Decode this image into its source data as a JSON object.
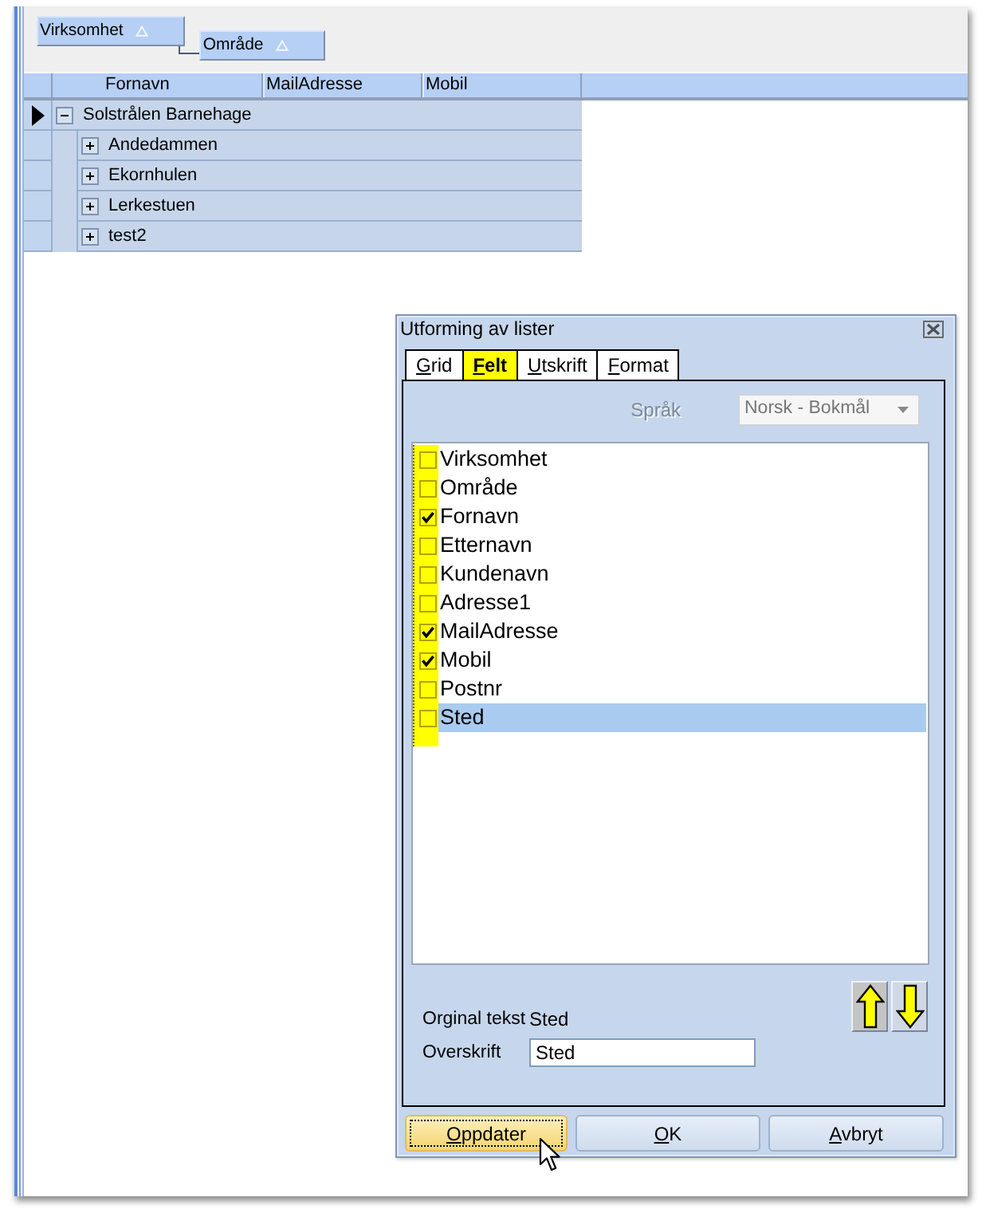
{
  "group_by": [
    {
      "label": "Virksomhet"
    },
    {
      "label": "Område"
    }
  ],
  "grid": {
    "columns": [
      "Fornavn",
      "MailAdresse",
      "Mobil"
    ],
    "rows": [
      {
        "label": "Solstrålen Barnehage",
        "current": true,
        "expanded": true,
        "children": [
          {
            "label": "Andedammen",
            "current": false,
            "expanded": false
          },
          {
            "label": "Ekornhulen",
            "current": false,
            "expanded": false
          },
          {
            "label": "Lerkestuen",
            "current": false,
            "expanded": false
          },
          {
            "label": "test2",
            "current": false,
            "expanded": false
          }
        ]
      }
    ]
  },
  "dialog": {
    "title": "Utforming av lister",
    "tabs": [
      {
        "label": "Grid",
        "selected": false,
        "mnemonic_underlined": true
      },
      {
        "label": "Felt",
        "selected": true,
        "mnemonic_underlined": true
      },
      {
        "label": "Utskrift",
        "selected": false,
        "mnemonic_underlined": true
      },
      {
        "label": "Format",
        "selected": false,
        "mnemonic_underlined": true
      }
    ],
    "language": {
      "label": "Språk",
      "value": "Norsk - Bokmål",
      "disabled": true
    },
    "fields": [
      {
        "label": "Virksomhet",
        "checked": false,
        "selected": false
      },
      {
        "label": "Område",
        "checked": false,
        "selected": false
      },
      {
        "label": "Fornavn",
        "checked": true,
        "selected": false
      },
      {
        "label": "Etternavn",
        "checked": false,
        "selected": false
      },
      {
        "label": "Kundenavn",
        "checked": false,
        "selected": false
      },
      {
        "label": "Adresse1",
        "checked": false,
        "selected": false
      },
      {
        "label": "MailAdresse",
        "checked": true,
        "selected": false
      },
      {
        "label": "Mobil",
        "checked": true,
        "selected": false
      },
      {
        "label": "Postnr",
        "checked": false,
        "selected": false
      },
      {
        "label": "Sted",
        "checked": false,
        "selected": true
      }
    ],
    "original_text": {
      "label": "Orginal tekst",
      "value": "Sted"
    },
    "heading": {
      "label": "Overskrift",
      "value": "Sted"
    },
    "buttons": [
      {
        "label": "Oppdater",
        "focused": true,
        "mnemonic_underlined": true
      },
      {
        "label": "OK",
        "focused": false,
        "mnemonic_underlined": true
      },
      {
        "label": "Avbryt",
        "focused": false,
        "mnemonic_underlined": true
      }
    ]
  }
}
